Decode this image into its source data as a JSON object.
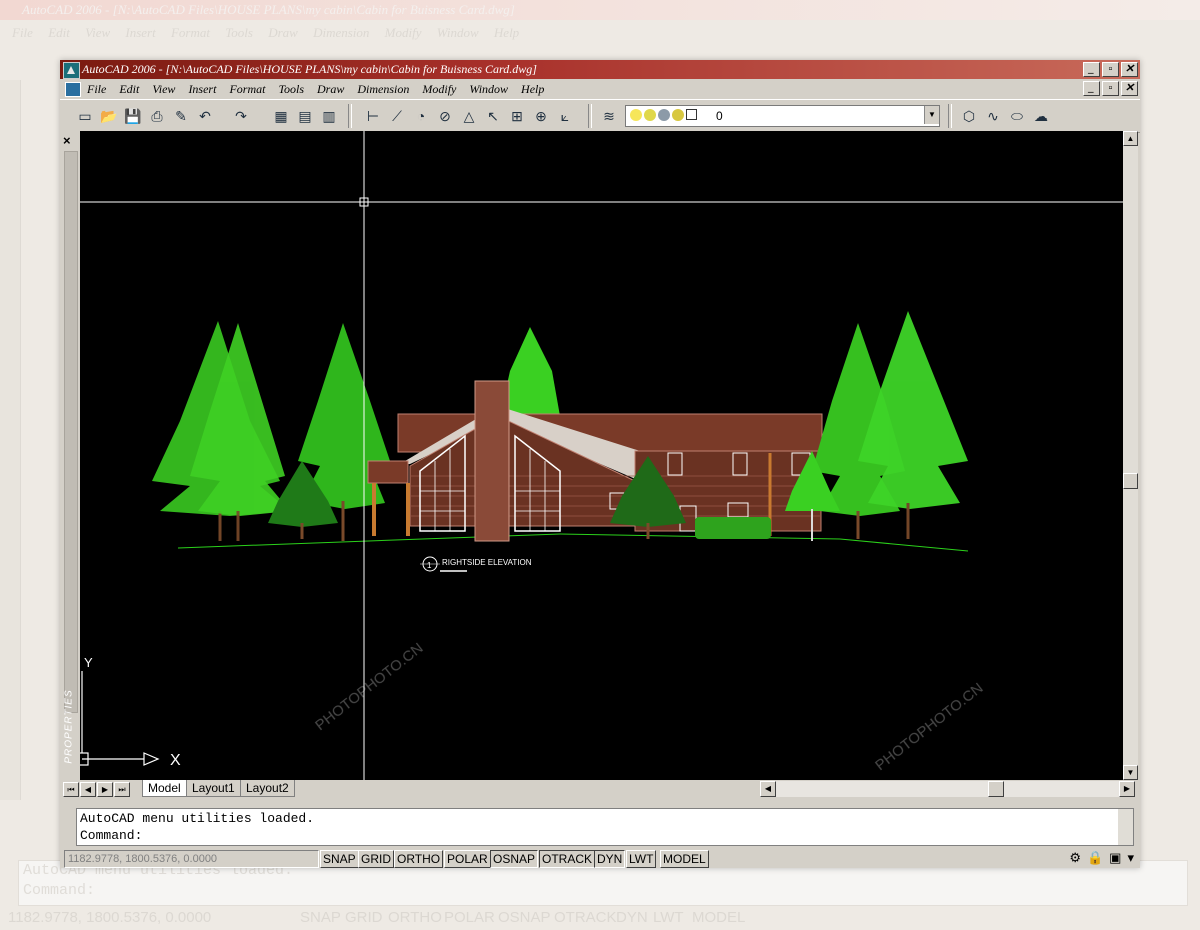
{
  "window": {
    "title": "AutoCAD 2006 - [N:\\AutoCAD Files\\HOUSE PLANS\\my cabin\\Cabin for Buisness Card.dwg]",
    "buttons": [
      "_",
      "▫",
      "✕"
    ]
  },
  "menu": [
    "File",
    "Edit",
    "View",
    "Insert",
    "Format",
    "Tools",
    "Draw",
    "Dimension",
    "Modify",
    "Window",
    "Help"
  ],
  "toolbar": {
    "layer_value": "0",
    "icons": [
      "new-icon",
      "open-icon",
      "save-icon",
      "plot-icon",
      "match-properties-icon",
      "undo-icon",
      "redo-icon",
      "design-center-icon",
      "tool-palettes-icon",
      "sheet-set-icon",
      "dimension-linear-icon",
      "dimension-aligned-icon",
      "dimension-radius-icon",
      "dimension-diameter-icon",
      "dimension-angular-icon",
      "quick-leader-icon",
      "tolerance-icon",
      "center-mark-icon",
      "dimension-edit-icon",
      "layer-manager-icon",
      "region-icon",
      "spline-icon",
      "ellipse-icon",
      "revision-cloud-icon"
    ]
  },
  "palette": {
    "title": "PROPERTIES"
  },
  "drawing": {
    "label": "RIGHTSIDE ELEVATION",
    "marker": "1",
    "ucs_x": "X",
    "ucs_y": "Y"
  },
  "watermark": "PHOTOPHOTO.CN",
  "tabs": [
    "Model",
    "Layout1",
    "Layout2"
  ],
  "command": {
    "history": "AutoCAD menu utilities loaded.",
    "prompt": "Command:",
    "input_value": ""
  },
  "status": {
    "coordinates": "1182.9778, 1800.5376, 0.0000",
    "toggles": [
      "SNAP",
      "GRID",
      "ORTHO",
      "POLAR",
      "OSNAP",
      "OTRACK",
      "DYN",
      "LWT",
      "MODEL"
    ]
  },
  "colors": {
    "canvas": "#000000",
    "trees": "#3ec82a",
    "house": "#7a3a28",
    "title_gradient_start": "#7a1a10"
  }
}
